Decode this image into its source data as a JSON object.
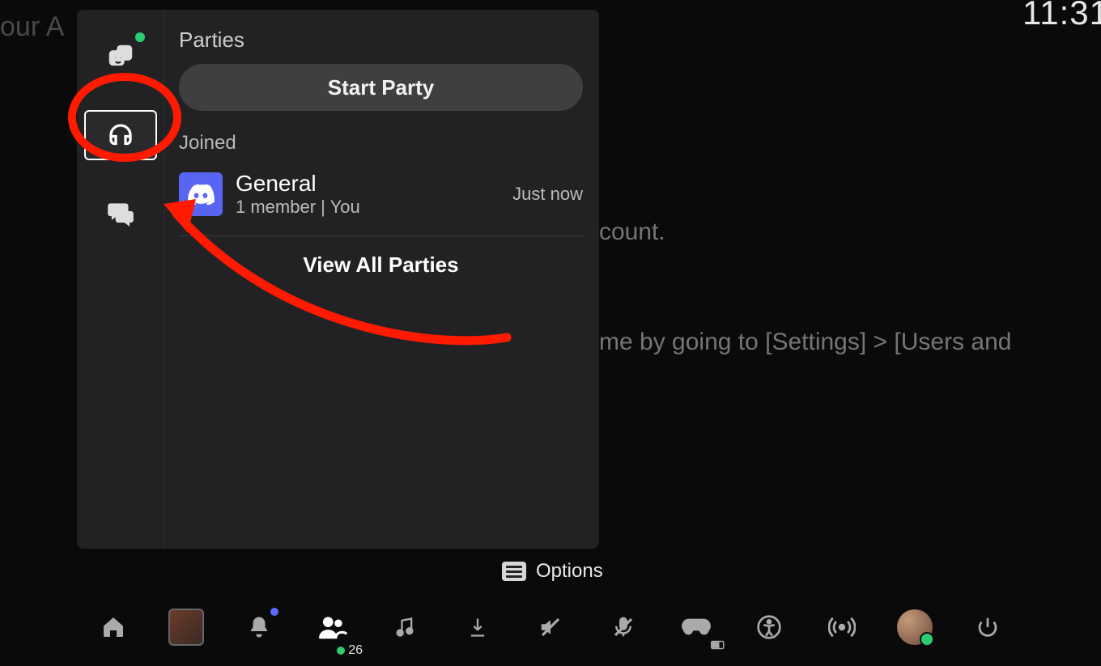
{
  "background": {
    "truncated_title": "our A",
    "line1_frag": "count.",
    "line2_frag": "me by going to [Settings] > [Users and"
  },
  "clock": "11:31",
  "panel": {
    "title": "Parties",
    "start_button": "Start Party",
    "joined_label": "Joined",
    "party": {
      "name": "General",
      "subtitle": "1 member  |  You",
      "time": "Just now"
    },
    "view_all": "View All Parties"
  },
  "hint": {
    "options": "Options"
  },
  "dock": {
    "friends_count": "26"
  }
}
